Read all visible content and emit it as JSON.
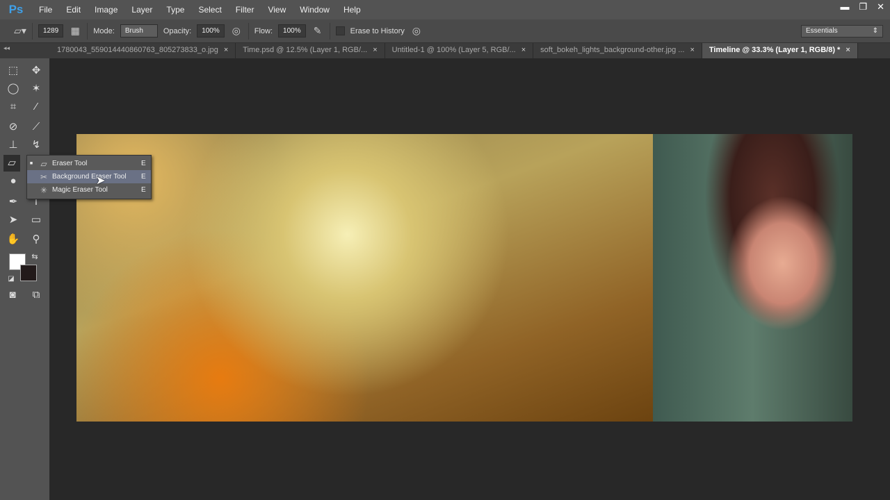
{
  "app": {
    "logo": "Ps"
  },
  "menu": [
    "File",
    "Edit",
    "Image",
    "Layer",
    "Type",
    "Select",
    "Filter",
    "View",
    "Window",
    "Help"
  ],
  "window_controls": {
    "minimize": "▬",
    "restore": "❐",
    "close": "✕"
  },
  "options": {
    "brush_size": "1289",
    "mode_label": "Mode:",
    "mode_value": "Brush",
    "opacity_label": "Opacity:",
    "opacity_value": "100%",
    "flow_label": "Flow:",
    "flow_value": "100%",
    "erase_to_history": "Erase to History",
    "erase_to_history_checked": false
  },
  "workspace": "Essentials",
  "panel_collapse": "◂◂",
  "tabs": [
    {
      "label": "1780043_559014440860763_805273833_o.jpg",
      "active": false
    },
    {
      "label": "Time.psd @ 12.5% (Layer 1, RGB/...",
      "active": false
    },
    {
      "label": "Untitled-1 @ 100% (Layer 5, RGB/...",
      "active": false
    },
    {
      "label": "soft_bokeh_lights_background-other.jpg ...",
      "active": false
    },
    {
      "label": "Timeline @ 33.3% (Layer 1, RGB/8) *",
      "active": true
    }
  ],
  "tab_close": "×",
  "flyout": [
    {
      "label": "Eraser Tool",
      "shortcut": "E",
      "current": true,
      "marker": "■",
      "icon": "eraser-icon"
    },
    {
      "label": "Background Eraser Tool",
      "shortcut": "E",
      "current": false,
      "marker": "",
      "icon": "background-eraser-icon"
    },
    {
      "label": "Magic Eraser Tool",
      "shortcut": "E",
      "current": false,
      "marker": "",
      "icon": "magic-eraser-icon"
    }
  ],
  "colors": {
    "foreground": "#ffffff",
    "background": "#221a1a",
    "accent": "#3fa0e8"
  }
}
